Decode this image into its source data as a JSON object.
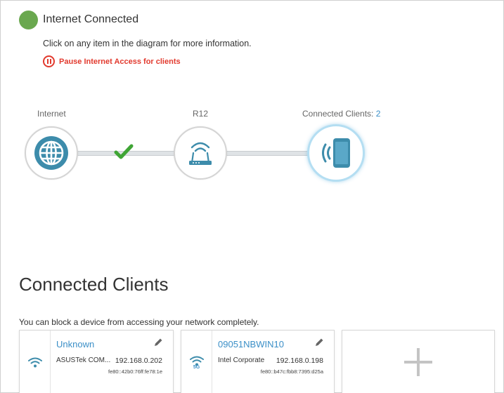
{
  "header": {
    "status_text": "Internet Connected",
    "status_color": "#6aa84f",
    "hint": "Click on any item in the diagram for more information.",
    "pause_label": "Pause Internet Access for clients"
  },
  "diagram": {
    "internet_label": "Internet",
    "router_label": "R12",
    "clients_label": "Connected Clients: ",
    "clients_count": "2",
    "internet_icon": "globe-icon",
    "router_icon": "router-icon",
    "clients_icon": "wireless-device-icon",
    "status_icon": "checkmark-icon"
  },
  "clients": {
    "title": "Connected Clients",
    "description": "You can block a device from accessing your network completely.",
    "items": [
      {
        "name": "Unknown",
        "vendor": "ASUSTek COM...",
        "ip": "192.168.0.202",
        "ipv6": "fe80::42b0:76ff:fe78:1e",
        "band": ""
      },
      {
        "name": "09051NBWIN10",
        "vendor": "Intel Corporate",
        "ip": "192.168.0.198",
        "ipv6": "fe80::b47c:fbb8:7395:d25a",
        "band": "5G"
      }
    ],
    "add_icon": "plus-icon"
  },
  "colors": {
    "accent": "#3b8fc7",
    "alert": "#e23a2e",
    "success": "#3fa535"
  }
}
